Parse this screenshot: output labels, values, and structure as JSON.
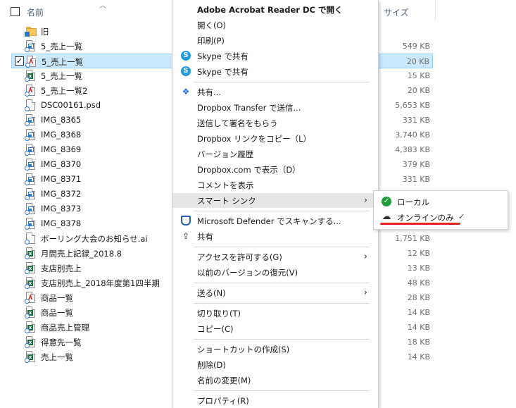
{
  "header": {
    "name": "名前",
    "size": "サイズ"
  },
  "files": [
    {
      "name": "旧",
      "size": "",
      "icon": "folder-icon",
      "checked": false,
      "selected": false
    },
    {
      "name": "5_売上一覧",
      "size": "549 KB",
      "icon": "image-file-icon",
      "checked": false,
      "selected": false
    },
    {
      "name": "5_売上一覧",
      "size": "20 KB",
      "icon": "pdf-file-icon",
      "checked": true,
      "selected": true
    },
    {
      "name": "5_売上一覧",
      "size": "15 KB",
      "icon": "excel-file-icon",
      "checked": false,
      "selected": false
    },
    {
      "name": "5_売上一覧2",
      "size": "20 KB",
      "icon": "pdf-file-icon",
      "checked": false,
      "selected": false
    },
    {
      "name": "DSC00161.psd",
      "size": "5,653 KB",
      "icon": "generic-file-icon",
      "checked": false,
      "selected": false
    },
    {
      "name": "IMG_8365",
      "size": "331 KB",
      "icon": "image-file-icon",
      "checked": false,
      "selected": false
    },
    {
      "name": "IMG_8368",
      "size": "3,740 KB",
      "icon": "image-file-icon",
      "checked": false,
      "selected": false
    },
    {
      "name": "IMG_8369",
      "size": "4,383 KB",
      "icon": "image-file-icon",
      "checked": false,
      "selected": false
    },
    {
      "name": "IMG_8370",
      "size": "379 KB",
      "icon": "image-file-icon",
      "checked": false,
      "selected": false
    },
    {
      "name": "IMG_8371",
      "size": "331 KB",
      "icon": "image-file-icon",
      "checked": false,
      "selected": false
    },
    {
      "name": "IMG_8372",
      "size": "",
      "icon": "image-file-icon",
      "checked": false,
      "selected": false
    },
    {
      "name": "IMG_8373",
      "size": "",
      "icon": "image-file-icon",
      "checked": false,
      "selected": false
    },
    {
      "name": "IMG_8378",
      "size": "",
      "icon": "image-file-icon",
      "checked": false,
      "selected": false
    },
    {
      "name": "ボーリング大会のお知らせ.ai",
      "size": "1,751 KB",
      "icon": "generic-file-icon",
      "checked": false,
      "selected": false
    },
    {
      "name": "月間売上記録_2018.8",
      "size": "12 KB",
      "icon": "excel-file-icon",
      "checked": false,
      "selected": false
    },
    {
      "name": "支店別売上",
      "size": "13 KB",
      "icon": "excel-file-icon",
      "checked": false,
      "selected": false
    },
    {
      "name": "支店別売上_2018年度第1四半期",
      "size": "48 KB",
      "icon": "excel-file-icon",
      "checked": false,
      "selected": false
    },
    {
      "name": "商品一覧",
      "size": "28 KB",
      "icon": "pdf-file-icon",
      "checked": false,
      "selected": false
    },
    {
      "name": "商品一覧",
      "size": "14 KB",
      "icon": "excel-file-icon",
      "checked": false,
      "selected": false
    },
    {
      "name": "商品売上管理",
      "size": "14 KB",
      "icon": "excel-file-icon",
      "checked": false,
      "selected": false
    },
    {
      "name": "得意先一覧",
      "size": "18 KB",
      "icon": "excel-file-icon",
      "checked": false,
      "selected": false
    },
    {
      "name": "売上一覧",
      "size": "14 KB",
      "icon": "excel-file-icon",
      "checked": false,
      "selected": false
    }
  ],
  "context_menu": {
    "items": [
      {
        "label": "Adobe Acrobat Reader DC で開く",
        "bold": true,
        "icon": ""
      },
      {
        "label": "開く(O)",
        "icon": ""
      },
      {
        "label": "印刷(P)",
        "icon": ""
      },
      {
        "label": "Skype で共有",
        "icon": "skype-icon"
      },
      {
        "label": "Skype で共有",
        "icon": "skype-icon"
      },
      {
        "separator": true
      },
      {
        "label": "共有...",
        "icon": "dropbox-icon"
      },
      {
        "label": "Dropbox Transfer で送信...",
        "icon": ""
      },
      {
        "label": "送信して署名をもらう",
        "icon": ""
      },
      {
        "label": "Dropbox リンクをコピー（L）",
        "icon": ""
      },
      {
        "label": "バージョン履歴",
        "icon": ""
      },
      {
        "label": "Dropbox.com で表示（D）",
        "icon": ""
      },
      {
        "label": "コメントを表示",
        "icon": ""
      },
      {
        "label": "スマート シンク",
        "icon": "",
        "submenu": true,
        "hover": true
      },
      {
        "separator": true
      },
      {
        "label": "Microsoft Defender でスキャンする...",
        "icon": "defender-icon"
      },
      {
        "label": "共有",
        "icon": "share-icon"
      },
      {
        "separator": true
      },
      {
        "label": "アクセスを許可する(G)",
        "icon": "",
        "submenu": true
      },
      {
        "label": "以前のバージョンの復元(V)",
        "icon": ""
      },
      {
        "separator": true
      },
      {
        "label": "送る(N)",
        "icon": "",
        "submenu": true
      },
      {
        "separator": true
      },
      {
        "label": "切り取り(T)",
        "icon": ""
      },
      {
        "label": "コピー(C)",
        "icon": ""
      },
      {
        "separator": true
      },
      {
        "label": "ショートカットの作成(S)",
        "icon": ""
      },
      {
        "label": "削除(D)",
        "icon": ""
      },
      {
        "label": "名前の変更(M)",
        "icon": ""
      },
      {
        "separator": true
      },
      {
        "label": "プロパティ(R)",
        "icon": ""
      }
    ]
  },
  "submenu": {
    "items": [
      {
        "label": "ローカル",
        "icon": "green-check-icon"
      },
      {
        "label": "オンラインのみ",
        "icon": "cloud-icon",
        "checkmark": "✓"
      }
    ]
  },
  "colors": {
    "selection_bg": "#cce8ff",
    "selection_border": "#99d1ff",
    "menu_hover": "#e6e6e6",
    "annotation_red": "#e0261f"
  }
}
